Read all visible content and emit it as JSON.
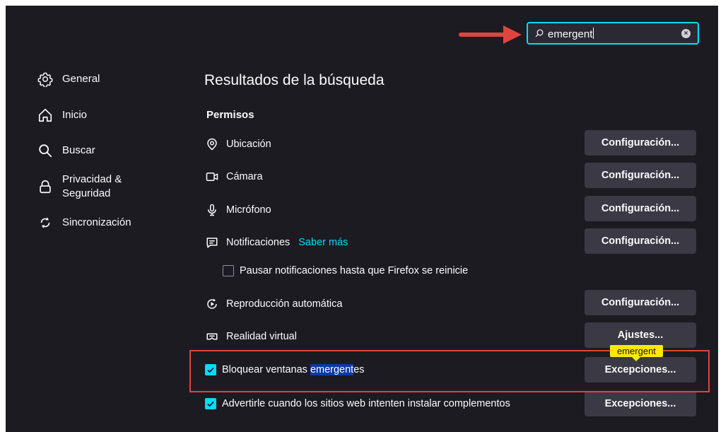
{
  "search": {
    "query": "emergent"
  },
  "sidebar": {
    "items": [
      {
        "label": "General",
        "icon": "gear-icon"
      },
      {
        "label": "Inicio",
        "icon": "home-icon"
      },
      {
        "label": "Buscar",
        "icon": "search-icon"
      },
      {
        "label": "Privacidad &\nSeguridad",
        "icon": "lock-icon"
      },
      {
        "label": "Sincronización",
        "icon": "sync-icon"
      }
    ]
  },
  "main": {
    "title": "Resultados de la búsqueda",
    "section": "Permisos",
    "permissions": [
      {
        "label": "Ubicación",
        "icon": "location-icon",
        "button": "Configuración..."
      },
      {
        "label": "Cámara",
        "icon": "camera-icon",
        "button": "Configuración..."
      },
      {
        "label": "Micrófono",
        "icon": "microphone-icon",
        "button": "Configuración..."
      },
      {
        "label": "Notificaciones",
        "icon": "notification-icon",
        "button": "Configuración...",
        "link": "Saber más"
      },
      {
        "label": "Reproducción automática",
        "icon": "autoplay-icon",
        "button": "Configuración..."
      },
      {
        "label": "Realidad virtual",
        "icon": "vr-icon",
        "button": "Ajustes..."
      }
    ],
    "pause_notifications": {
      "label": "Pausar notificaciones hasta que Firefox se reinicie",
      "checked": false
    },
    "block_popups": {
      "label_before": "Bloquear ventanas ",
      "label_match": "emergent",
      "label_after": "es",
      "checked": true,
      "button": "Excepciones...",
      "tooltip": "emergent"
    },
    "warn_addons": {
      "label": "Advertirle cuando los sitios web intenten instalar complementos",
      "checked": true,
      "button": "Excepciones..."
    }
  },
  "colors": {
    "background": "#1c1b22",
    "accent": "#00ddff",
    "button": "#3a3944",
    "highlight": "#0b3aa8",
    "annotation": "#e0443e",
    "tooltip": "#ffe900"
  }
}
